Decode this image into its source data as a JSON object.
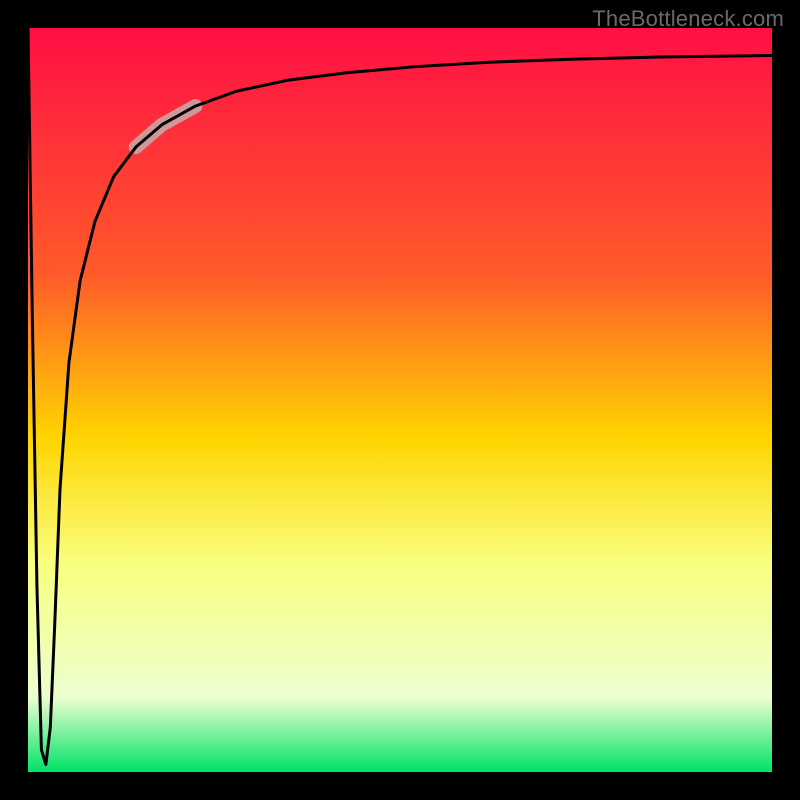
{
  "watermark": "TheBottleneck.com",
  "chart_data": {
    "type": "line",
    "title": "",
    "xlabel": "",
    "ylabel": "",
    "xlim": [
      0,
      100
    ],
    "ylim": [
      0,
      100
    ],
    "frame": {
      "outer": 14,
      "inner": 14
    },
    "gradient_colors": {
      "top": "#ff0f44",
      "upper": "#ff5a2a",
      "mid": "#ffd400",
      "lower": "#f9ff7f",
      "pale": "#ecffd0",
      "bottom": "#00e266"
    },
    "gradient_stops": [
      {
        "offset": 0.0,
        "key": "top"
      },
      {
        "offset": 0.33,
        "key": "upper"
      },
      {
        "offset": 0.55,
        "key": "mid"
      },
      {
        "offset": 0.72,
        "key": "lower"
      },
      {
        "offset": 0.9,
        "key": "pale"
      },
      {
        "offset": 1.0,
        "key": "bottom"
      }
    ],
    "x": [
      0,
      0.6,
      1.2,
      1.8,
      2.4,
      3.0,
      3.6,
      4.3,
      5.5,
      7.0,
      9.0,
      11.5,
      14.5,
      18.0,
      22.5,
      28.0,
      35.0,
      43.0,
      52.0,
      62.0,
      73.0,
      85.0,
      100.0
    ],
    "y": [
      100,
      60,
      25,
      3,
      1,
      6,
      20,
      38,
      55,
      66,
      74,
      80,
      84,
      87,
      89.5,
      91.5,
      93,
      94,
      94.8,
      95.4,
      95.8,
      96.1,
      96.3
    ],
    "highlight_segment": {
      "x_start": 14.5,
      "x_end": 22.5
    },
    "highlight_style": {
      "color": "#caa4a4",
      "width": 14,
      "opacity": 0.9
    }
  }
}
